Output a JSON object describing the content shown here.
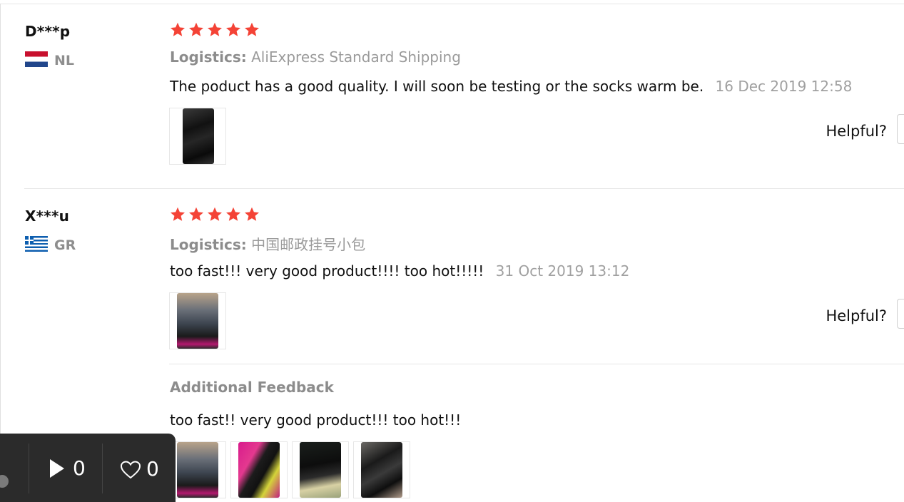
{
  "colors": {
    "star": "#f44336",
    "muted": "#9a9a9a",
    "player_bg": "#2b2b2b"
  },
  "reviews": [
    {
      "user": "D***p",
      "country": "NL",
      "flag": "netherlands-flag",
      "rating": 5,
      "logistics_label": "Logistics:",
      "logistics_value": "AliExpress Standard Shipping",
      "text": "The poduct has a good quality. I will soon be testing or the socks warm be.",
      "date": "16 Dec 2019 12:58",
      "helpful_label": "Helpful?"
    },
    {
      "user": "X***u",
      "country": "GR",
      "flag": "greece-flag",
      "rating": 5,
      "logistics_label": "Logistics:",
      "logistics_value": "中国邮政挂号小包",
      "text": "too fast!!! very good product!!!! too hot!!!!!",
      "date": "31 Oct 2019 13:12",
      "helpful_label": "Helpful?",
      "additional": {
        "title": "Additional Feedback",
        "text": "too fast!! very good product!!! too hot!!!"
      }
    }
  ],
  "player": {
    "play_count": "0",
    "like_count": "0"
  }
}
